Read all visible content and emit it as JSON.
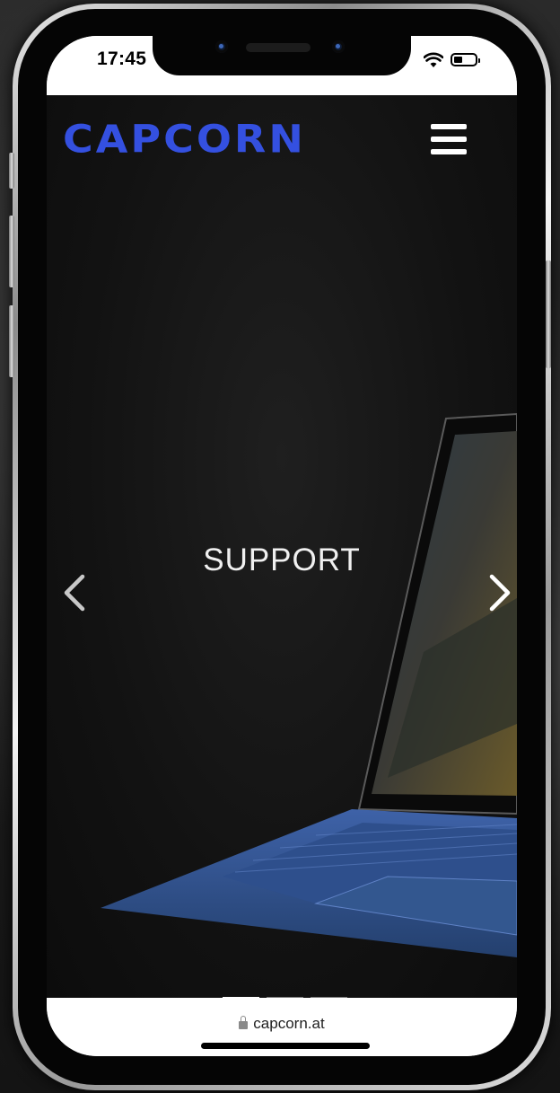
{
  "status_bar": {
    "time": "17:45"
  },
  "header": {
    "logo": "CAPCORN",
    "menu_icon": "hamburger-menu-icon"
  },
  "slider": {
    "title": "SUPPORT",
    "prev_icon": "chevron-left-icon",
    "next_icon": "chevron-right-icon",
    "slide_count": 3,
    "active_slide": 1
  },
  "browser": {
    "url": "capcorn.at",
    "lock_icon": "lock-icon"
  },
  "colors": {
    "brand": "#3450e0",
    "background": "#121212",
    "accent_keyboard": "#3a5ea0"
  }
}
